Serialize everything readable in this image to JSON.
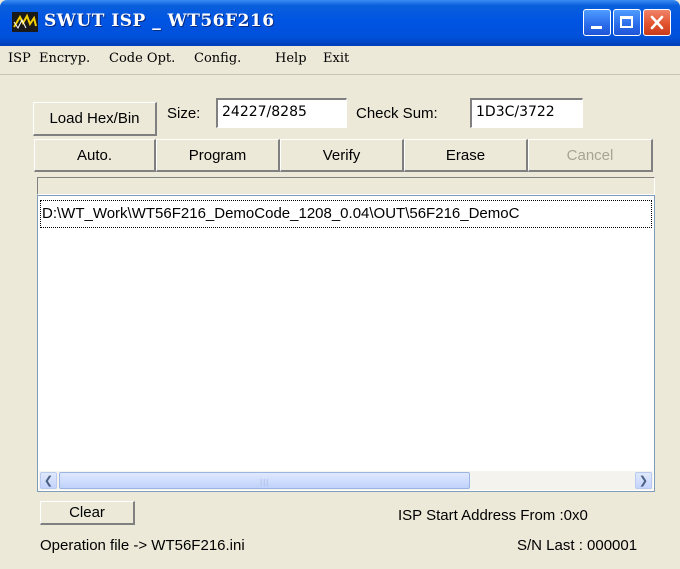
{
  "window": {
    "title": "SWUT ISP _ WT56F216",
    "controls": [
      "minimize",
      "maximize",
      "close"
    ]
  },
  "menu": [
    "ISP",
    "Encryp.",
    "Code Opt.",
    "Config.",
    "Help",
    "Exit"
  ],
  "toolbar": {
    "load_label": "Load Hex/Bin",
    "size_label": "Size:",
    "size_value": "24227/8285",
    "checksum_label": "Check Sum:",
    "checksum_value": "1D3C/3722"
  },
  "actions": {
    "auto": "Auto.",
    "program": "Program",
    "verify": "Verify",
    "erase": "Erase",
    "cancel": "Cancel"
  },
  "log": {
    "lines": [
      "D:\\WT_Work\\WT56F216_DemoCode_1208_0.04\\OUT\\56F216_DemoC"
    ]
  },
  "footer": {
    "clear_label": "Clear",
    "isp_start": "ISP Start Address From :0x0",
    "operation_file": "Operation file -> WT56F216.ini",
    "sn_last": "S/N Last : 000001"
  },
  "icons": {
    "app": "wave-logo-icon",
    "scroll_left": "arrow-left-icon",
    "scroll_right": "arrow-right-icon"
  }
}
